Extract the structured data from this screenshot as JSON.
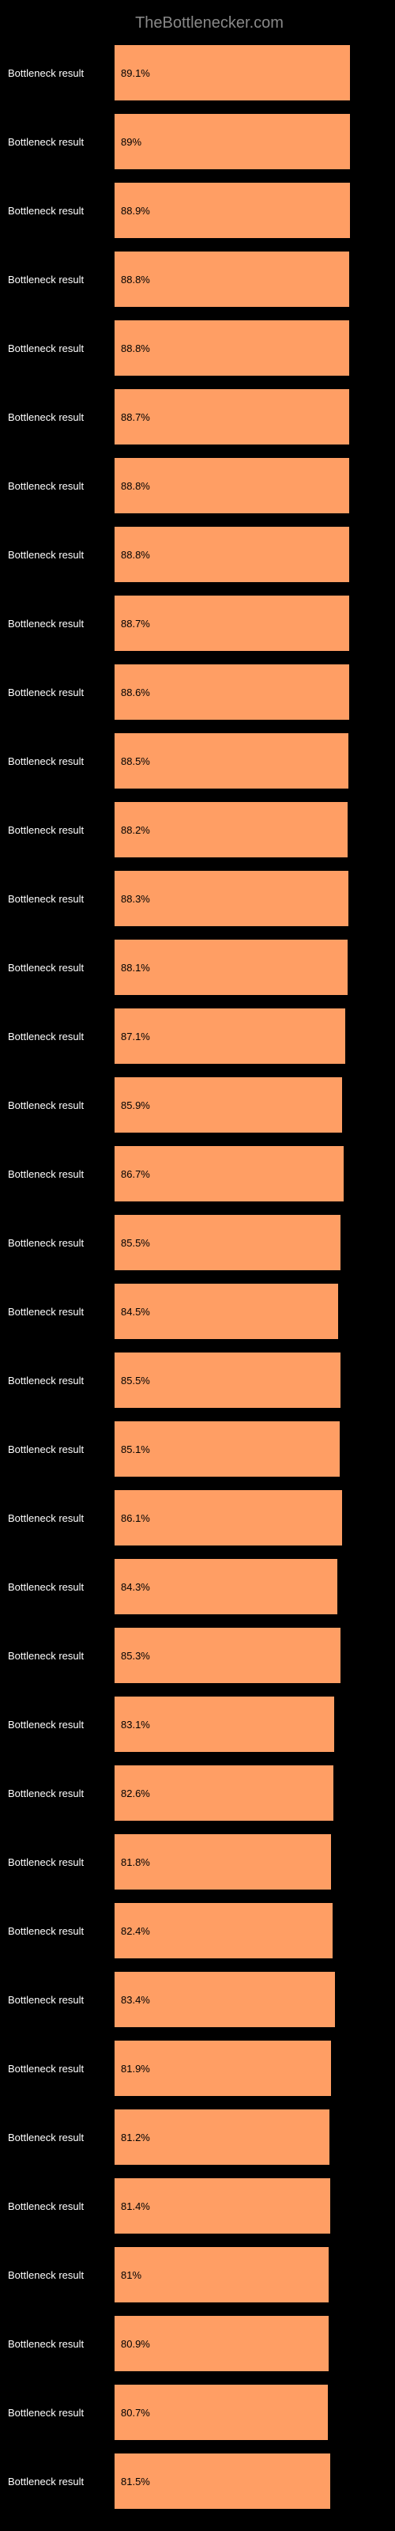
{
  "header": {
    "title": "TheBottlenecker.com"
  },
  "chart_data": {
    "type": "bar",
    "title": "TheBottlenecker.com",
    "xlabel": "",
    "ylabel": "",
    "xlim": [
      0,
      100
    ],
    "categories": [
      "Bottleneck result",
      "Bottleneck result",
      "Bottleneck result",
      "Bottleneck result",
      "Bottleneck result",
      "Bottleneck result",
      "Bottleneck result",
      "Bottleneck result",
      "Bottleneck result",
      "Bottleneck result",
      "Bottleneck result",
      "Bottleneck result",
      "Bottleneck result",
      "Bottleneck result",
      "Bottleneck result",
      "Bottleneck result",
      "Bottleneck result",
      "Bottleneck result",
      "Bottleneck result",
      "Bottleneck result",
      "Bottleneck result",
      "Bottleneck result",
      "Bottleneck result",
      "Bottleneck result",
      "Bottleneck result",
      "Bottleneck result",
      "Bottleneck result",
      "Bottleneck result",
      "Bottleneck result",
      "Bottleneck result",
      "Bottleneck result",
      "Bottleneck result",
      "Bottleneck result",
      "Bottleneck result",
      "Bottleneck result",
      "Bottleneck result"
    ],
    "values": [
      89.1,
      89.0,
      88.9,
      88.8,
      88.8,
      88.7,
      88.8,
      88.8,
      88.7,
      88.6,
      88.5,
      88.2,
      88.3,
      88.1,
      87.1,
      85.9,
      86.7,
      85.5,
      84.5,
      85.5,
      85.1,
      86.1,
      84.3,
      85.3,
      83.1,
      82.6,
      81.8,
      82.4,
      83.4,
      81.9,
      81.2,
      81.4,
      81.0,
      80.9,
      80.7,
      81.5
    ],
    "bar_color": "#ff9e64",
    "background": "#000000"
  },
  "rows": [
    {
      "label": "Bottleneck result",
      "value": "89.1%",
      "width": 89.1
    },
    {
      "label": "Bottleneck result",
      "value": "89%",
      "width": 89.0
    },
    {
      "label": "Bottleneck result",
      "value": "88.9%",
      "width": 88.9
    },
    {
      "label": "Bottleneck result",
      "value": "88.8%",
      "width": 88.8
    },
    {
      "label": "Bottleneck result",
      "value": "88.8%",
      "width": 88.8
    },
    {
      "label": "Bottleneck result",
      "value": "88.7%",
      "width": 88.7
    },
    {
      "label": "Bottleneck result",
      "value": "88.8%",
      "width": 88.8
    },
    {
      "label": "Bottleneck result",
      "value": "88.8%",
      "width": 88.8
    },
    {
      "label": "Bottleneck result",
      "value": "88.7%",
      "width": 88.7
    },
    {
      "label": "Bottleneck result",
      "value": "88.6%",
      "width": 88.6
    },
    {
      "label": "Bottleneck result",
      "value": "88.5%",
      "width": 88.5
    },
    {
      "label": "Bottleneck result",
      "value": "88.2%",
      "width": 88.2
    },
    {
      "label": "Bottleneck result",
      "value": "88.3%",
      "width": 88.3
    },
    {
      "label": "Bottleneck result",
      "value": "88.1%",
      "width": 88.1
    },
    {
      "label": "Bottleneck result",
      "value": "87.1%",
      "width": 87.1
    },
    {
      "label": "Bottleneck result",
      "value": "85.9%",
      "width": 85.9
    },
    {
      "label": "Bottleneck result",
      "value": "86.7%",
      "width": 86.7
    },
    {
      "label": "Bottleneck result",
      "value": "85.5%",
      "width": 85.5
    },
    {
      "label": "Bottleneck result",
      "value": "84.5%",
      "width": 84.5
    },
    {
      "label": "Bottleneck result",
      "value": "85.5%",
      "width": 85.5
    },
    {
      "label": "Bottleneck result",
      "value": "85.1%",
      "width": 85.1
    },
    {
      "label": "Bottleneck result",
      "value": "86.1%",
      "width": 86.1
    },
    {
      "label": "Bottleneck result",
      "value": "84.3%",
      "width": 84.3
    },
    {
      "label": "Bottleneck result",
      "value": "85.3%",
      "width": 85.3
    },
    {
      "label": "Bottleneck result",
      "value": "83.1%",
      "width": 83.1
    },
    {
      "label": "Bottleneck result",
      "value": "82.6%",
      "width": 82.6
    },
    {
      "label": "Bottleneck result",
      "value": "81.8%",
      "width": 81.8
    },
    {
      "label": "Bottleneck result",
      "value": "82.4%",
      "width": 82.4
    },
    {
      "label": "Bottleneck result",
      "value": "83.4%",
      "width": 83.4
    },
    {
      "label": "Bottleneck result",
      "value": "81.9%",
      "width": 81.9
    },
    {
      "label": "Bottleneck result",
      "value": "81.2%",
      "width": 81.2
    },
    {
      "label": "Bottleneck result",
      "value": "81.4%",
      "width": 81.4
    },
    {
      "label": "Bottleneck result",
      "value": "81%",
      "width": 81.0
    },
    {
      "label": "Bottleneck result",
      "value": "80.9%",
      "width": 80.9
    },
    {
      "label": "Bottleneck result",
      "value": "80.7%",
      "width": 80.7
    },
    {
      "label": "Bottleneck result",
      "value": "81.5%",
      "width": 81.5
    }
  ]
}
